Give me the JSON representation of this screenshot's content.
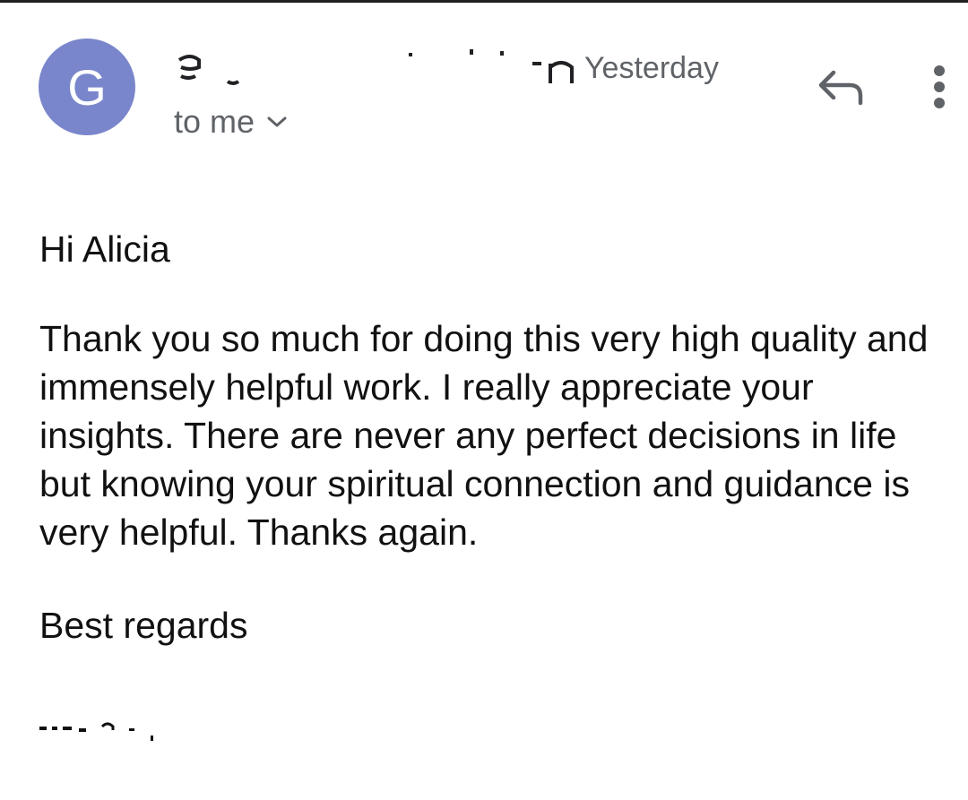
{
  "header": {
    "avatar_letter": "G",
    "sender_name": "gG– –  – – –  – –   –n",
    "timestamp": "Yesterday",
    "recipient_label": "to me"
  },
  "icons": {
    "reply": "reply-icon",
    "more": "more-vert-icon",
    "expand": "chevron-down-icon"
  },
  "message": {
    "greeting": "Hi Alicia",
    "paragraph": "Thank you so much for doing this very high quality and immensely helpful work. I really appreciate your insights. There are never any perfect decisions in life but knowing your spiritual connection and guidance is very helpful. Thanks again.",
    "signoff": "Best regards"
  },
  "colors": {
    "avatar_bg": "#7986cb",
    "secondary_text": "#5f6368",
    "body_text": "#111111"
  }
}
